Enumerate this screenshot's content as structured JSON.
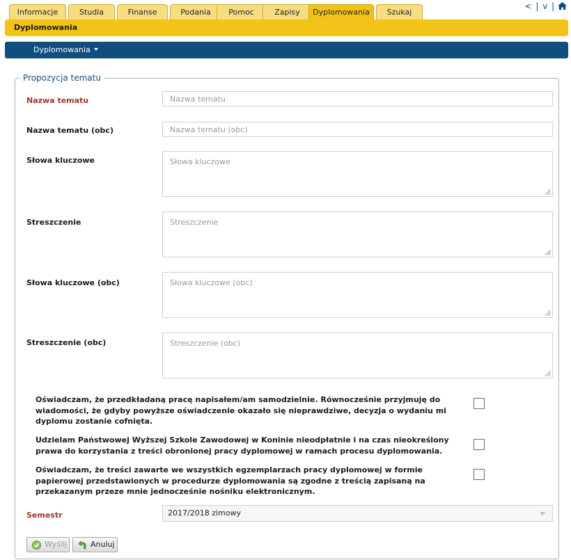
{
  "tabs": [
    {
      "label": "Informacje"
    },
    {
      "label": "Studia"
    },
    {
      "label": "Finanse"
    },
    {
      "label": "Podania"
    },
    {
      "label": "Pomoc"
    },
    {
      "label": "Zapisy"
    },
    {
      "label": "Dyplomowania",
      "active": true
    },
    {
      "label": "Szukaj"
    }
  ],
  "top_links": {
    "prev": "<",
    "sep1": "|",
    "next": "v",
    "sep2": "|",
    "home_icon": "home-icon"
  },
  "header": {
    "title": "Dyplomowania"
  },
  "nav": {
    "menu_label": "Dyplomowania"
  },
  "form": {
    "legend": "Propozycja tematu",
    "fields": {
      "nazwa": {
        "label": "Nazwa tematu",
        "placeholder": "Nazwa tematu",
        "required": true
      },
      "nazwa_obc": {
        "label": "Nazwa tematu (obc)",
        "placeholder": "Nazwa tematu (obc)"
      },
      "slowa": {
        "label": "Słowa kluczowe",
        "placeholder": "Słowa kluczowe"
      },
      "streszczenie": {
        "label": "Streszczenie",
        "placeholder": "Streszczenie"
      },
      "slowa_obc": {
        "label": "Słowa kluczowe (obc)",
        "placeholder": "Słowa kluczowe (obc)"
      },
      "streszczenie_obc": {
        "label": "Streszczenie (obc)",
        "placeholder": "Streszczenie (obc)"
      }
    },
    "declarations": [
      {
        "text": "Oświadczam, że przedkładaną pracę napisałem/am samodzielnie. Równocześnie przyjmuję do wiadomości, że gdyby powyższe oświadczenie okazało się nieprawdziwe, decyzja o wydaniu mi dyplomu zostanie cofnięta.",
        "checked": false
      },
      {
        "text": "Udzielam Państwowej Wyższej Szkole Zawodowej w Koninie nieodpłatnie i na czas nieokreślony prawa do korzystania z treści obronionej pracy dyplomowej w ramach procesu dyplomowania.",
        "checked": false
      },
      {
        "text": "Oświadczam, że treści zawarte we wszystkich egzemplarzach pracy dyplomowej w formie papierowej przedstawionych w procedurze dyplomowania są zgodne z treścią zapisaną na przekazanym przeze mnie jednocześnie nośniku elektronicznym.",
        "checked": false
      }
    ],
    "semester": {
      "label": "Semestr",
      "selected": "2017/2018 zimowy"
    },
    "buttons": {
      "send": "Wyślij",
      "cancel": "Anuluj"
    }
  },
  "colors": {
    "tab": "#f7dd80",
    "tab_active": "#f1c31a",
    "header_bar": "#f2c418",
    "nav_bar": "#0e4f7e",
    "required_label": "#a0362d",
    "legend": "#1a4d80"
  }
}
